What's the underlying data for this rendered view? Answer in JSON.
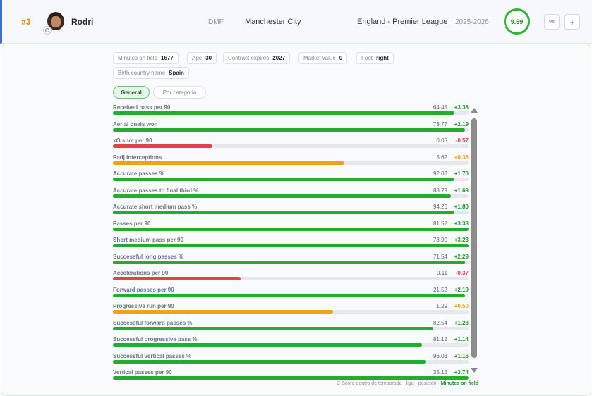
{
  "player": {
    "rank": "#3",
    "name": "Rodri",
    "position": "DMF",
    "team": "Manchester City",
    "league": "England - Premier League",
    "season": "2025-2026",
    "rating": "9.69"
  },
  "actions": {
    "vs_label": "vs",
    "add_label": "+"
  },
  "chips": [
    {
      "label": "Minutes on field",
      "value": "1677"
    },
    {
      "label": "Age",
      "value": "30"
    },
    {
      "label": "Contract expires",
      "value": "2027"
    },
    {
      "label": "Market value",
      "value": "0"
    },
    {
      "label": "Foot",
      "value": "right"
    },
    {
      "label": "Birth country name",
      "value": "Spain"
    }
  ],
  "tabs": [
    {
      "label": "General",
      "active": true
    },
    {
      "label": "Por categoria",
      "active": false
    }
  ],
  "colors": {
    "green": "#22ad2b",
    "red": "#e24446",
    "orange": "#f4a01c",
    "track": "#e6e8ee"
  },
  "metrics": [
    {
      "label": "Received pass per 90",
      "value": "64.45",
      "delta": "+3.38",
      "fill": 0.96,
      "color": "green"
    },
    {
      "label": "Aerial duels won",
      "value": "73.77",
      "delta": "+2.19",
      "fill": 0.99,
      "color": "green"
    },
    {
      "label": "xG shot per 90",
      "value": "0.05",
      "delta": "-0.57",
      "fill": 0.28,
      "color": "red"
    },
    {
      "label": "Padj interceptions",
      "value": "5.62",
      "delta": "+0.38",
      "fill": 0.65,
      "color": "orange"
    },
    {
      "label": "Accurate passes %",
      "value": "92.03",
      "delta": "+1.70",
      "fill": 0.96,
      "color": "green"
    },
    {
      "label": "Accurate passes to final third %",
      "value": "88.79",
      "delta": "+1.69",
      "fill": 0.95,
      "color": "green"
    },
    {
      "label": "Accurate short medium pass %",
      "value": "94.26",
      "delta": "+1.80",
      "fill": 0.96,
      "color": "green"
    },
    {
      "label": "Passes per 90",
      "value": "81.52",
      "delta": "+3.38",
      "fill": 1.0,
      "color": "green"
    },
    {
      "label": "Short medium pass per 90",
      "value": "73.90",
      "delta": "+3.23",
      "fill": 1.0,
      "color": "green"
    },
    {
      "label": "Successful long passes %",
      "value": "71.54",
      "delta": "+2.29",
      "fill": 0.99,
      "color": "green"
    },
    {
      "label": "Accelerations per 90",
      "value": "0.11",
      "delta": "-0.37",
      "fill": 0.36,
      "color": "red"
    },
    {
      "label": "Forward passes per 90",
      "value": "21.52",
      "delta": "+2.19",
      "fill": 0.99,
      "color": "green"
    },
    {
      "label": "Progressive run per 90",
      "value": "1.29",
      "delta": "+0.50",
      "fill": 0.62,
      "color": "orange"
    },
    {
      "label": "Successful forward passes %",
      "value": "82.54",
      "delta": "+1.28",
      "fill": 0.9,
      "color": "green"
    },
    {
      "label": "Successful progressive pass %",
      "value": "81.12",
      "delta": "+1.14",
      "fill": 0.87,
      "color": "green"
    },
    {
      "label": "Successful vertical passes %",
      "value": "96.03",
      "delta": "+1.16",
      "fill": 0.88,
      "color": "green"
    },
    {
      "label": "Vertical passes per 90",
      "value": "35.15",
      "delta": "+3.74",
      "fill": 1.0,
      "color": "green"
    }
  ],
  "footnote": {
    "text": "Z-Score dentro de temporada · liga · posición · ",
    "highlight": "Minutes on field"
  }
}
